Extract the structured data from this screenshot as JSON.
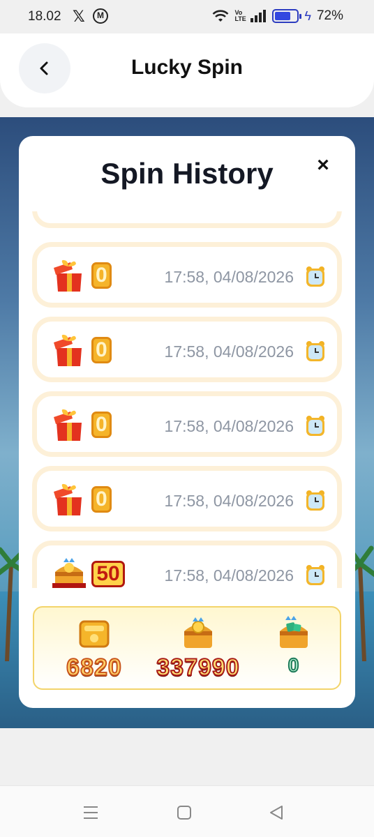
{
  "status_bar": {
    "time": "18.02",
    "x_app": "𝕏",
    "m_app": "M",
    "battery_level": "72%",
    "battery_fraction": 0.72,
    "volte": "Vo LTE"
  },
  "header": {
    "title": "Lucky Spin",
    "back_icon": "chevron-left-icon"
  },
  "modal": {
    "title": "Spin History",
    "close_label": "×",
    "rows": [
      {
        "icon": "gift-box-icon",
        "value": "0",
        "time": "17:58, 04/08/2026"
      },
      {
        "icon": "gift-box-icon",
        "value": "0",
        "time": "17:58, 04/08/2026"
      },
      {
        "icon": "gift-box-icon",
        "value": "0",
        "time": "17:58, 04/08/2026"
      },
      {
        "icon": "gift-box-icon",
        "value": "0",
        "time": "17:58, 04/08/2026"
      },
      {
        "icon": "treasure-chest-icon",
        "value": "50",
        "time": "17:58, 04/08/2026"
      }
    ],
    "totals": {
      "tickets": "6820",
      "coins": "337990",
      "gems": "0"
    }
  },
  "colors": {
    "row_border": "#fdf0d8",
    "time_text": "#8e96a3",
    "totals_border": "#f3d46a"
  }
}
